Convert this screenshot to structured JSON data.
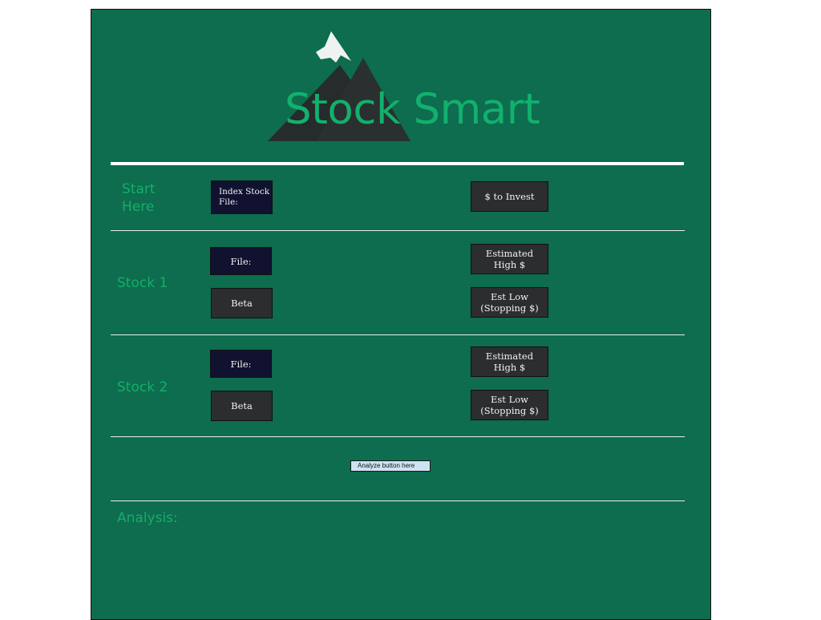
{
  "logo": {
    "title": "Stock Smart"
  },
  "colors": {
    "background": "#0d6d4e",
    "accent": "#12b06e",
    "navy_box": "#101230",
    "charcoal_box": "#2b2d2e",
    "analyze_button": "#cfe2f3"
  },
  "start": {
    "label": "Start\nHere",
    "index_file_label": "Index Stock\nFile:",
    "invest_label": "$ to Invest"
  },
  "stock1": {
    "label": "Stock 1",
    "file_label": "File:",
    "beta_label": "Beta",
    "high_label": "Estimated\nHigh $",
    "low_label": "Est Low\n(Stopping $)"
  },
  "stock2": {
    "label": "Stock 2",
    "file_label": "File:",
    "beta_label": "Beta",
    "high_label": "Estimated\nHigh $",
    "low_label": "Est Low\n(Stopping $)"
  },
  "analyze": {
    "label": "Analyze button here"
  },
  "analysis": {
    "label": "Analysis:"
  }
}
